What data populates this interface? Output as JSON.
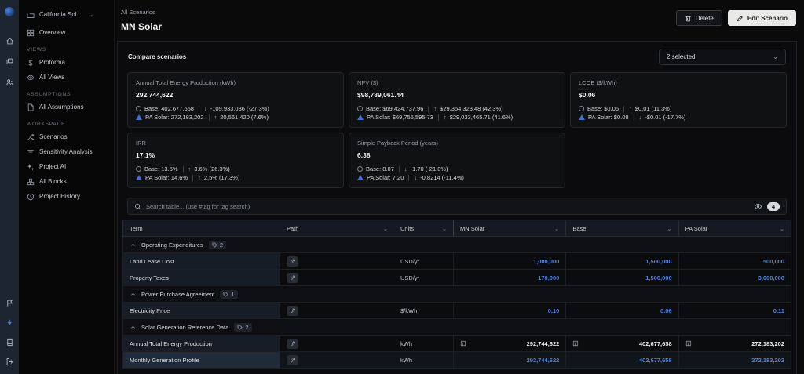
{
  "rail": {
    "icons": [
      "home-icon",
      "windows-icon",
      "users-icon"
    ],
    "bottom_icons": [
      "flag-icon",
      "bolt-icon",
      "book-icon",
      "logout-icon"
    ]
  },
  "sidebar": {
    "project": {
      "label": "California Sol...",
      "icon": "folder-icon"
    },
    "overview": {
      "label": "Overview",
      "icon": "grid-icon"
    },
    "sections": [
      {
        "title": "VIEWS",
        "items": [
          {
            "label": "Proforma",
            "icon": "dollar-icon"
          },
          {
            "label": "All Views",
            "icon": "views-icon"
          }
        ]
      },
      {
        "title": "ASSUMPTIONS",
        "items": [
          {
            "label": "All Assumptions",
            "icon": "document-icon"
          }
        ]
      },
      {
        "title": "WORKSPACE",
        "items": [
          {
            "label": "Scenarios",
            "icon": "branch-icon"
          },
          {
            "label": "Sensitivity Analysis",
            "icon": "filter-icon"
          },
          {
            "label": "Project AI",
            "icon": "sparkle-icon"
          },
          {
            "label": "All Blocks",
            "icon": "blocks-icon"
          },
          {
            "label": "Project History",
            "icon": "history-icon"
          }
        ]
      }
    ]
  },
  "header": {
    "breadcrumb": "All Scenarios",
    "title": "MN Solar",
    "delete_label": "Delete",
    "edit_label": "Edit Scenario"
  },
  "compare": {
    "label": "Compare scenarios",
    "selected": "2 selected"
  },
  "kpis": [
    {
      "title": "Annual Total Energy Production (kWh)",
      "value": "292,744,622",
      "base": {
        "label": "Base: 402,677,658",
        "arrow": "↓",
        "delta": "-109,933,036 (-27.3%)"
      },
      "pa": {
        "label": "PA Solar: 272,183,202",
        "arrow": "↑",
        "delta": "20,561,420 (7.6%)"
      }
    },
    {
      "title": "NPV ($)",
      "value": "$98,789,061.44",
      "base": {
        "label": "Base: $69,424,737.96",
        "arrow": "↑",
        "delta": "$29,364,323.48 (42.3%)"
      },
      "pa": {
        "label": "PA Solar: $69,755,595.73",
        "arrow": "↑",
        "delta": "$29,033,465.71 (41.6%)"
      }
    },
    {
      "title": "LCOE ($/kWh)",
      "value": "$0.06",
      "base": {
        "label": "Base: $0.06",
        "arrow": "↑",
        "delta": "$0.01 (11.3%)"
      },
      "pa": {
        "label": "PA Solar: $0.08",
        "arrow": "↓",
        "delta": "-$0.01 (-17.7%)"
      }
    },
    {
      "title": "IRR",
      "value": "17.1%",
      "base": {
        "label": "Base: 13.5%",
        "arrow": "↑",
        "delta": "3.6% (26.3%)"
      },
      "pa": {
        "label": "PA Solar: 14.6%",
        "arrow": "↑",
        "delta": "2.5% (17.3%)"
      }
    },
    {
      "title": "Simple Payback Period (years)",
      "value": "6.38",
      "base": {
        "label": "Base: 8.07",
        "arrow": "↓",
        "delta": "-1.70 (-21.0%)"
      },
      "pa": {
        "label": "PA Solar: 7.20",
        "arrow": "↓",
        "delta": "-0.8214 (-11.4%)"
      }
    }
  ],
  "search": {
    "placeholder": "Search table... (use #tag for tag search)",
    "visible_count": "4"
  },
  "table": {
    "columns": [
      "Term",
      "Path",
      "Units",
      "MN Solar",
      "Base",
      "PA Solar"
    ],
    "sections": [
      {
        "name": "Operating Expenditures",
        "count": "2",
        "rows": [
          {
            "term": "Land Lease Cost",
            "units": "USD/yr",
            "values": [
              "1,000,000",
              "1,500,000",
              "500,000"
            ]
          },
          {
            "term": "Property Taxes",
            "units": "USD/yr",
            "values": [
              "170,000",
              "1,500,000",
              "3,000,000"
            ]
          }
        ]
      },
      {
        "name": "Power Purchase Agreement",
        "count": "1",
        "rows": [
          {
            "term": "Electricity Price",
            "units": "$/kWh",
            "values": [
              "0.10",
              "0.06",
              "0.11"
            ]
          }
        ]
      },
      {
        "name": "Solar Generation Reference Data",
        "count": "2",
        "rows": [
          {
            "term": "Annual Total Energy Production",
            "units": "kWh",
            "values": [
              "292,744,622",
              "402,677,658",
              "272,183,202"
            ]
          },
          {
            "term": "Monthly Generation Profile",
            "units": "kWh",
            "values": [
              "292,744,622",
              "402,677,658",
              "272,183,202"
            ]
          }
        ]
      }
    ]
  },
  "colors": {
    "accent_blue": "#4d82dd",
    "edit_button_bg": "#e9e9e7"
  }
}
